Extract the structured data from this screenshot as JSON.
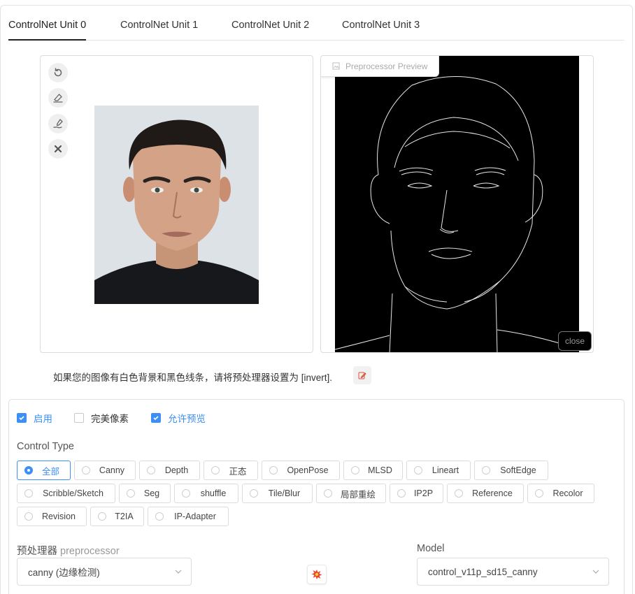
{
  "tabs": [
    {
      "label": "ControlNet Unit 0",
      "active": true
    },
    {
      "label": "ControlNet Unit 1",
      "active": false
    },
    {
      "label": "ControlNet Unit 2",
      "active": false
    },
    {
      "label": "ControlNet Unit 3",
      "active": false
    }
  ],
  "image_tools": [
    "undo-icon",
    "eraser-icon",
    "brush-icon",
    "close-icon"
  ],
  "preview": {
    "label": "Preprocessor Preview",
    "close_label": "close"
  },
  "hint": {
    "text": "如果您的图像有白色背景和黑色线条，请将预处理器设置为 [invert].",
    "button_icon": "edit-icon"
  },
  "checkboxes": [
    {
      "label": "启用",
      "checked": true
    },
    {
      "label": "完美像素",
      "checked": false
    },
    {
      "label": "允许预览",
      "checked": true
    }
  ],
  "control_type": {
    "title": "Control Type",
    "options": [
      "全部",
      "Canny",
      "Depth",
      "正态",
      "OpenPose",
      "MLSD",
      "Lineart",
      "SoftEdge",
      "Scribble/Sketch",
      "Seg",
      "shuffle",
      "Tile/Blur",
      "局部重绘",
      "IP2P",
      "Reference",
      "Recolor",
      "Revision",
      "T2IA",
      "IP-Adapter"
    ],
    "selected": "全部"
  },
  "preprocessor": {
    "title": "预处理器",
    "title_sub": "preprocessor",
    "value": "canny (边缘检测)"
  },
  "model": {
    "title": "Model",
    "value": "control_v11p_sd15_canny"
  },
  "colors": {
    "accent": "#3b8ff5"
  }
}
